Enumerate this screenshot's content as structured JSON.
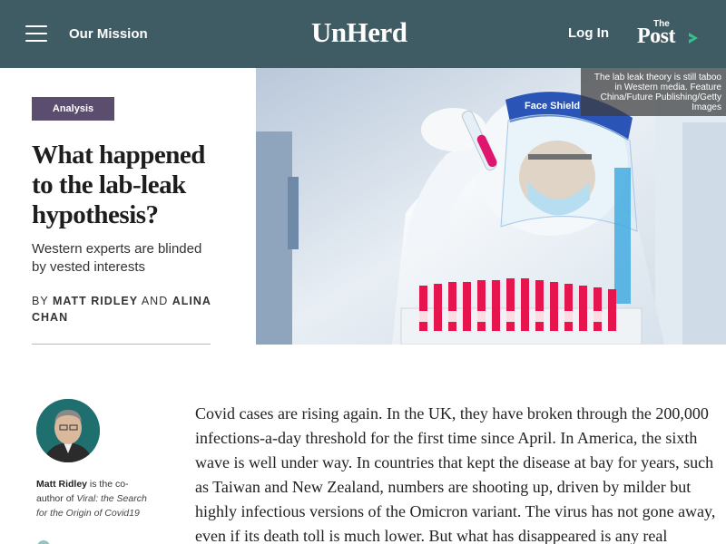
{
  "header": {
    "menu_icon": "hamburger-menu-icon",
    "mission_label": "Our Mission",
    "logo_text": "UnHerd",
    "login_label": "Log In",
    "post_logo_small": "The",
    "post_logo_big": "Post",
    "post_arrow_icon": "chevron-right-icon",
    "colors": {
      "background": "#3f5b63",
      "text": "#ffffff",
      "post_arrow": "#34c38f"
    }
  },
  "article": {
    "tag": "Analysis",
    "tag_color": "#5b4d6e",
    "headline": "What happened to the lab-leak hypothesis?",
    "subtitle": "Western experts are blinded by vested interests",
    "byline_prefix": "BY",
    "author_1": "MATT RIDLEY",
    "byline_join": "AND",
    "author_2": "ALINA CHAN",
    "image_caption": "The lab leak theory is still taboo in Western media. Feature China/Future Publishing/Getty Images",
    "body_text": "Covid cases are rising again. In the UK, they have broken through the 200,000 infections-a-day threshold for the first time since April. In America, the sixth wave is well under way. In countries that kept the disease at bay for years, such as Taiwan and New Zealand, numbers are shooting up, driven by milder but highly infectious versions of the Omicron variant. The virus has not gone away, even if its death toll is much lower. But what has disappeared is any real"
  },
  "author_box": {
    "name": "Matt Ridley",
    "bio_middle": " is the co-author of ",
    "book_title": "Viral: the Search for the Origin of Covid19",
    "avatar_bg": "#1f6f6e"
  }
}
